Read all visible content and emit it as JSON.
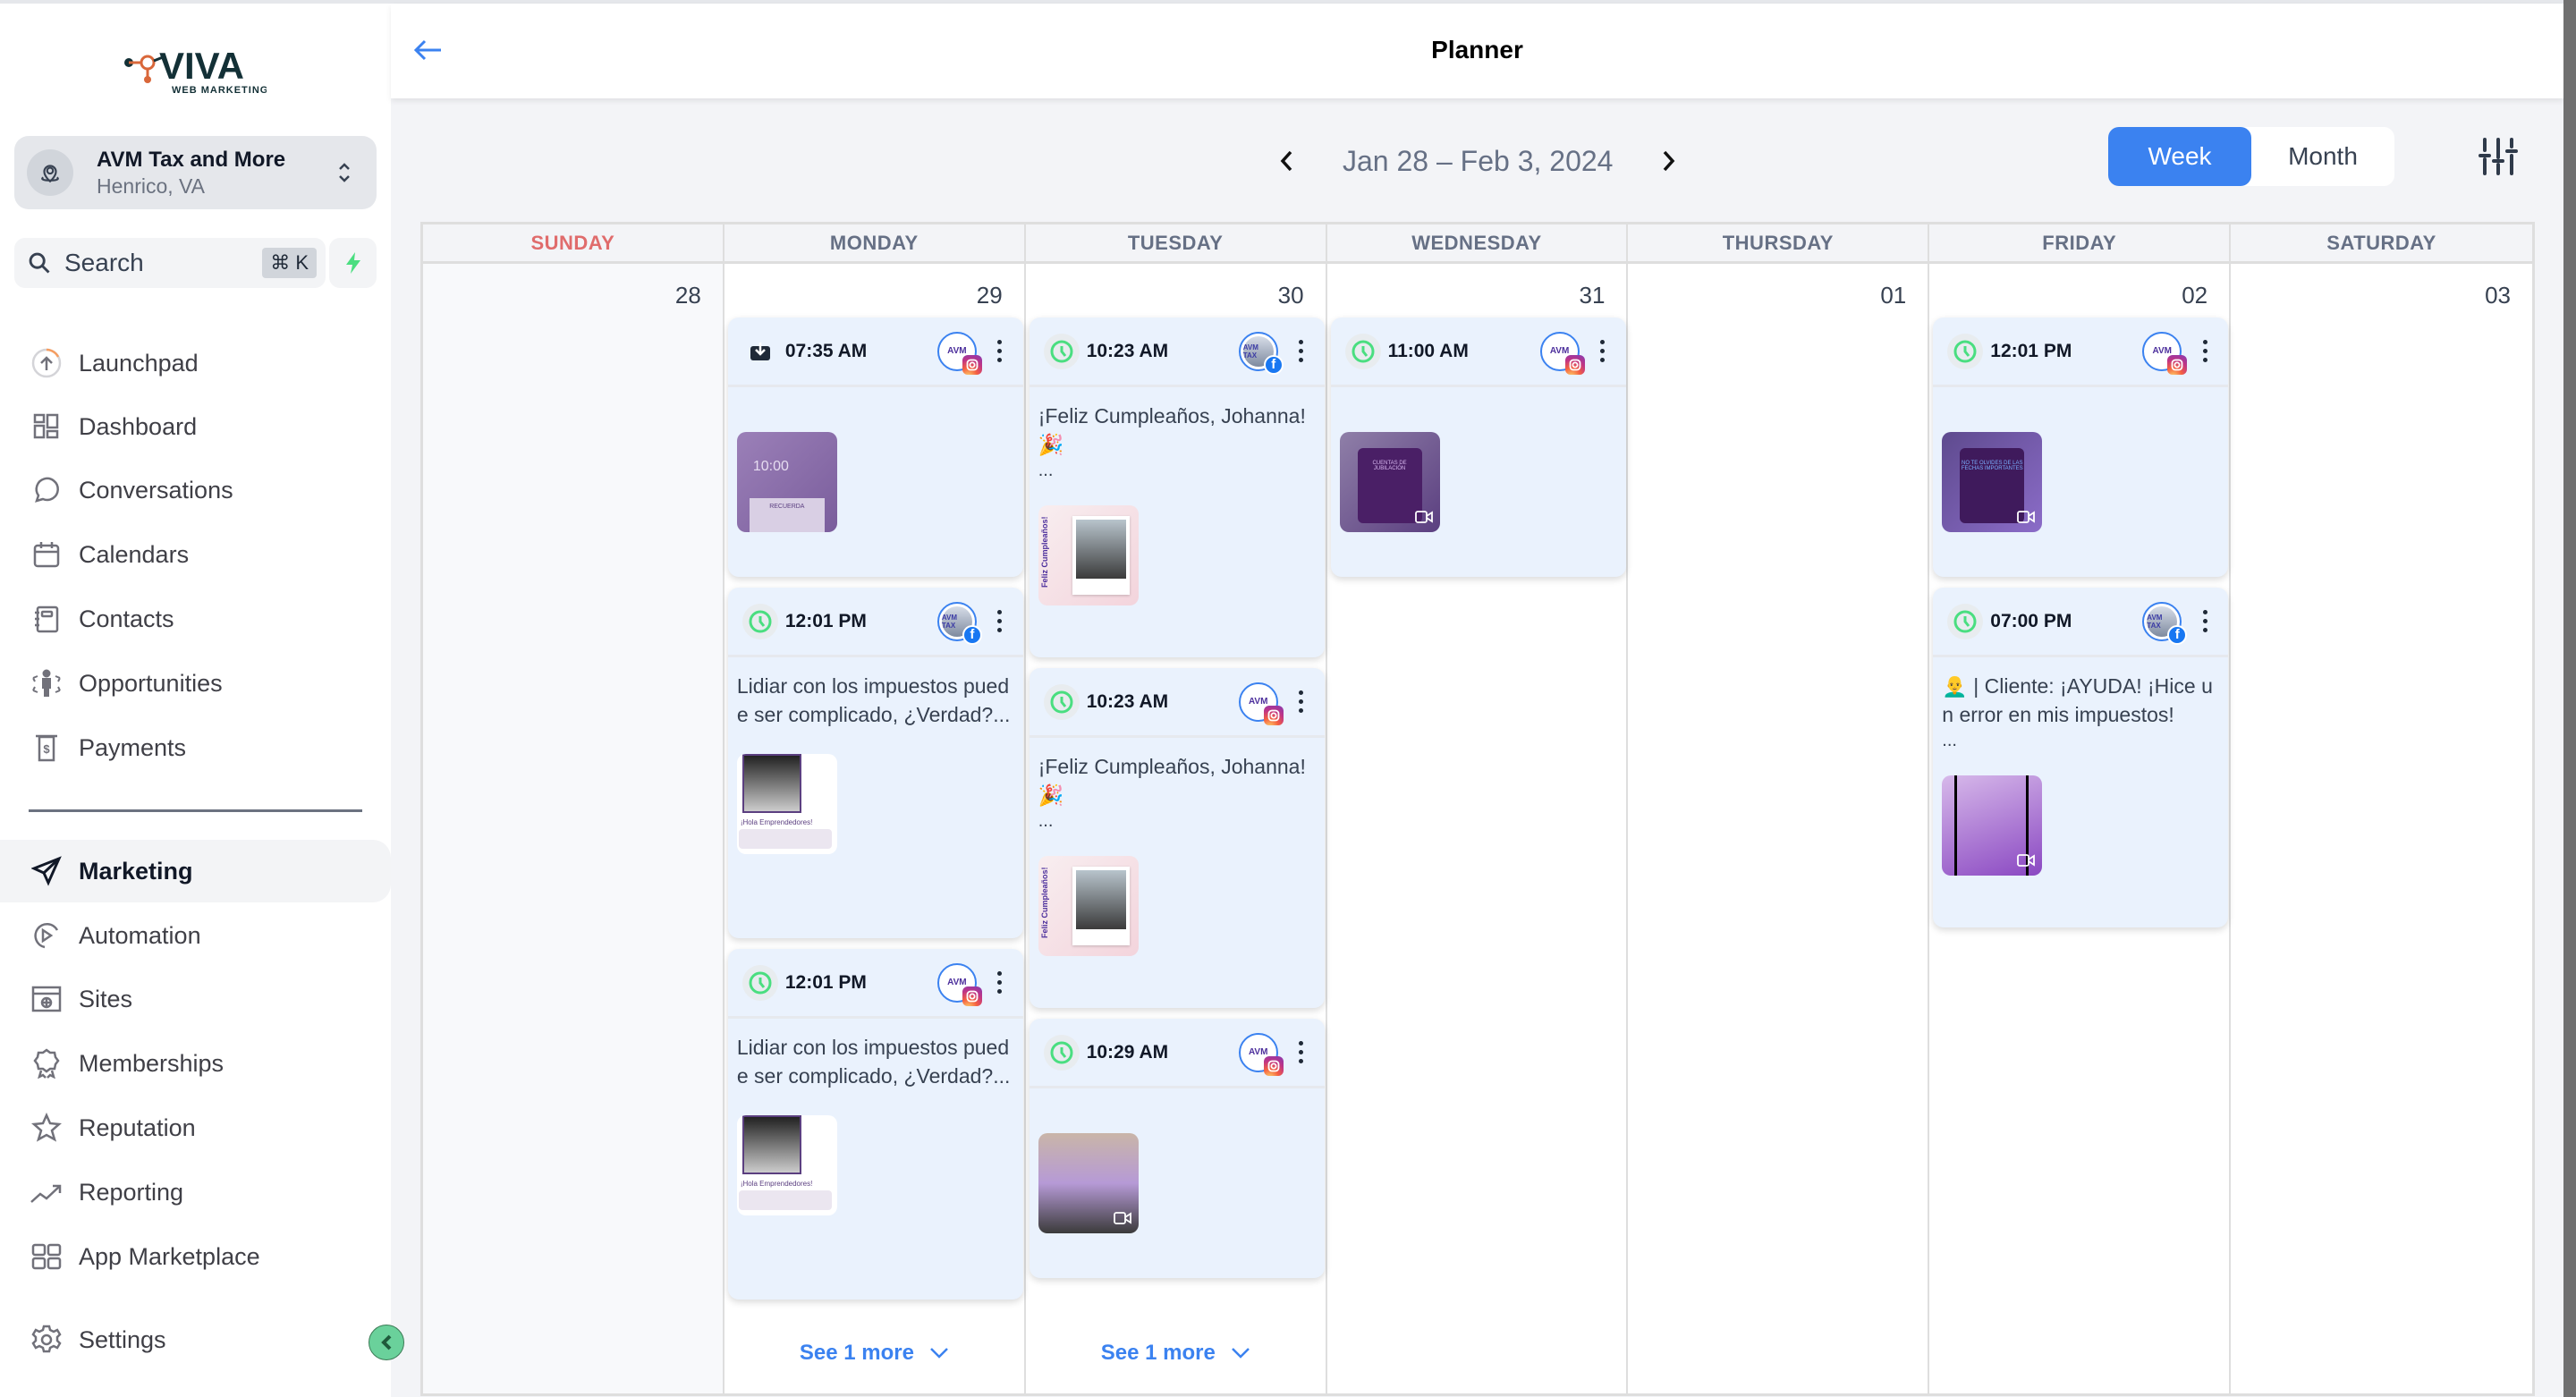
{
  "brand": {
    "name": "VIVA",
    "tagline": "WEB MARKETING",
    "colors": {
      "dark": "#133036",
      "accent": "#d9673a"
    }
  },
  "location": {
    "name": "AVM Tax and More",
    "sub": "Henrico, VA"
  },
  "search": {
    "label": "Search",
    "shortcut": "⌘ K"
  },
  "sidebar": {
    "items": [
      {
        "label": "Launchpad",
        "icon": "launchpad-icon"
      },
      {
        "label": "Dashboard",
        "icon": "dashboard-icon"
      },
      {
        "label": "Conversations",
        "icon": "chat-bubble-icon"
      },
      {
        "label": "Calendars",
        "icon": "calendar-icon"
      },
      {
        "label": "Contacts",
        "icon": "contacts-book-icon"
      },
      {
        "label": "Opportunities",
        "icon": "opportunities-icon"
      },
      {
        "label": "Payments",
        "icon": "payments-icon"
      },
      {
        "label": "Marketing",
        "icon": "paper-plane-icon",
        "active": true
      },
      {
        "label": "Automation",
        "icon": "automation-play-icon"
      },
      {
        "label": "Sites",
        "icon": "sites-globe-icon"
      },
      {
        "label": "Memberships",
        "icon": "badge-award-icon"
      },
      {
        "label": "Reputation",
        "icon": "star-icon"
      },
      {
        "label": "Reporting",
        "icon": "trend-chart-icon"
      },
      {
        "label": "App Marketplace",
        "icon": "app-grid-icon"
      },
      {
        "label": "Settings",
        "icon": "gear-icon"
      }
    ]
  },
  "header": {
    "title": "Planner",
    "back_icon": "arrow-left-icon"
  },
  "toolbar": {
    "range": "Jan 28 – Feb 3, 2024",
    "views": [
      {
        "label": "Week",
        "active": true
      },
      {
        "label": "Month",
        "active": false
      }
    ],
    "accent": "#3b82f0"
  },
  "calendar": {
    "days": [
      {
        "name": "SUNDAY",
        "date": "28",
        "posts": []
      },
      {
        "name": "MONDAY",
        "date": "29",
        "see_more": "See 1 more",
        "posts": [
          {
            "time": "07:35 AM",
            "status_icon": "download-icon",
            "network": "instagram",
            "text": "",
            "media": "recuerda"
          },
          {
            "time": "12:01 PM",
            "status_icon": "clock-icon",
            "network": "facebook",
            "text": "Lidiar con los impuestos puede ser complicado, ¿Verdad?...",
            "media": "emprendedores"
          },
          {
            "time": "12:01 PM",
            "status_icon": "clock-icon",
            "network": "instagram",
            "text": "Lidiar con los impuestos puede ser complicado, ¿Verdad?...",
            "media": "emprendedores"
          }
        ]
      },
      {
        "name": "TUESDAY",
        "date": "30",
        "see_more": "See 1 more",
        "posts": [
          {
            "time": "10:23 AM",
            "status_icon": "clock-icon",
            "network": "facebook",
            "text": "¡Feliz Cumpleaños, Johanna! 🎉",
            "ellipsis": "...",
            "media": "cumple"
          },
          {
            "time": "10:23 AM",
            "status_icon": "clock-icon",
            "network": "instagram",
            "text": "¡Feliz Cumpleaños, Johanna! 🎉",
            "ellipsis": "...",
            "media": "cumple"
          },
          {
            "time": "10:29 AM",
            "status_icon": "clock-icon",
            "network": "instagram",
            "text": "",
            "media": "happy",
            "video": true
          }
        ]
      },
      {
        "name": "WEDNESDAY",
        "date": "31",
        "posts": [
          {
            "time": "11:00 AM",
            "status_icon": "clock-icon",
            "network": "instagram",
            "text": "",
            "media": "jubilacion",
            "video": true
          }
        ]
      },
      {
        "name": "THURSDAY",
        "date": "01",
        "posts": []
      },
      {
        "name": "FRIDAY",
        "date": "02",
        "posts": [
          {
            "time": "12:01 PM",
            "status_icon": "clock-icon",
            "network": "instagram",
            "text": "",
            "media": "fechas",
            "video": true
          },
          {
            "time": "07:00 PM",
            "status_icon": "clock-icon",
            "network": "facebook",
            "text": "👨‍🦲 | Cliente: ¡AYUDA! ¡Hice un error en mis impuestos!",
            "ellipsis": "...",
            "media": "purple",
            "video": true
          }
        ]
      },
      {
        "name": "SATURDAY",
        "date": "03",
        "posts": []
      }
    ],
    "media_text": {
      "recuerda_time": "10:00",
      "recuerda_label": "RECUERDA",
      "emprendedores_label": "¡Hola Emprendedores!",
      "cumple_label": "Feliz Cumpleaños!",
      "jubilacion_label": "CUENTAS DE JUBILACIÓN",
      "fechas_label": "NO TE OLVIDES DE LAS FECHAS IMPORTANTES",
      "account_ig": "AVM",
      "account_fb": "AVM TAX"
    }
  }
}
